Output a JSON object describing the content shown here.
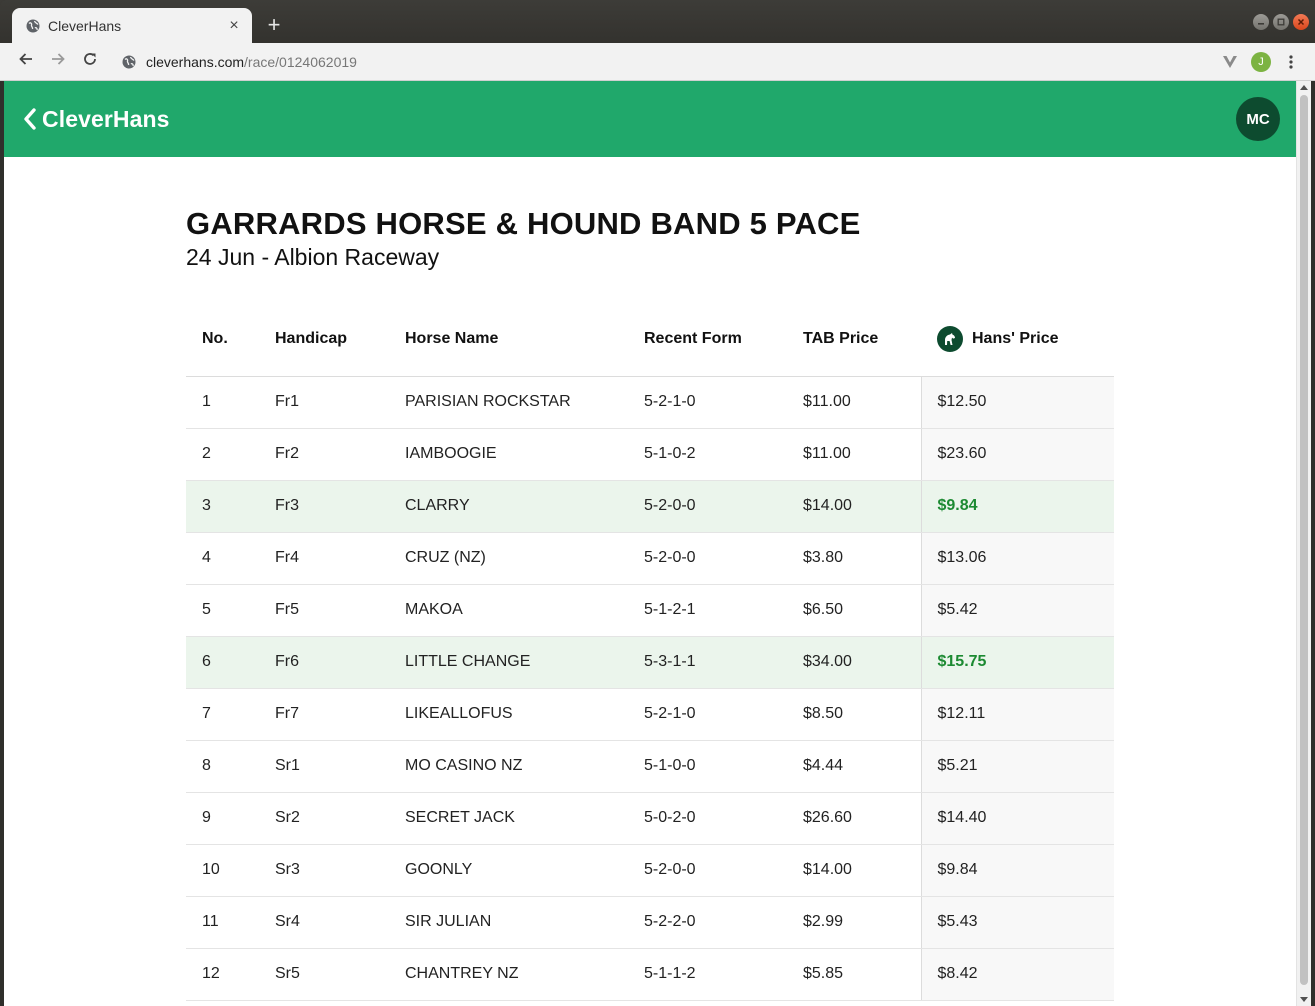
{
  "browser": {
    "tab_title": "CleverHans",
    "tab_close_glyph": "×",
    "new_tab_glyph": "+",
    "url_host": "cleverhans.com",
    "url_path": "/race/0124062019",
    "profile_initial": "J",
    "icons": [
      "globe-icon",
      "back-arrow-icon",
      "forward-arrow-icon",
      "reload-icon",
      "extension-icon",
      "menu-dots-icon"
    ]
  },
  "app": {
    "brand": "CleverHans",
    "avatar_initials": "MC",
    "accent_color": "#20a86b",
    "dark_green": "#0d4b2f",
    "highlight_color": "#1c8a32"
  },
  "race": {
    "title": "GARRARDS HORSE & HOUND BAND 5 PACE",
    "subtitle": "24 Jun - Albion Raceway"
  },
  "table": {
    "headers": {
      "no": "No.",
      "handicap": "Handicap",
      "horse": "Horse Name",
      "form": "Recent Form",
      "tab": "TAB Price",
      "hans": "Hans' Price"
    },
    "rows": [
      {
        "no": "1",
        "handicap": "Fr1",
        "horse": "PARISIAN ROCKSTAR",
        "form": "5-2-1-0",
        "tab": "$11.00",
        "hans": "$12.50",
        "highlight": false
      },
      {
        "no": "2",
        "handicap": "Fr2",
        "horse": "IAMBOOGIE",
        "form": "5-1-0-2",
        "tab": "$11.00",
        "hans": "$23.60",
        "highlight": false
      },
      {
        "no": "3",
        "handicap": "Fr3",
        "horse": "CLARRY",
        "form": "5-2-0-0",
        "tab": "$14.00",
        "hans": "$9.84",
        "highlight": true
      },
      {
        "no": "4",
        "handicap": "Fr4",
        "horse": "CRUZ (NZ)",
        "form": "5-2-0-0",
        "tab": "$3.80",
        "hans": "$13.06",
        "highlight": false
      },
      {
        "no": "5",
        "handicap": "Fr5",
        "horse": "MAKOA",
        "form": "5-1-2-1",
        "tab": "$6.50",
        "hans": "$5.42",
        "highlight": false
      },
      {
        "no": "6",
        "handicap": "Fr6",
        "horse": "LITTLE CHANGE",
        "form": "5-3-1-1",
        "tab": "$34.00",
        "hans": "$15.75",
        "highlight": true
      },
      {
        "no": "7",
        "handicap": "Fr7",
        "horse": "LIKEALLOFUS",
        "form": "5-2-1-0",
        "tab": "$8.50",
        "hans": "$12.11",
        "highlight": false
      },
      {
        "no": "8",
        "handicap": "Sr1",
        "horse": "MO CASINO NZ",
        "form": "5-1-0-0",
        "tab": "$4.44",
        "hans": "$5.21",
        "highlight": false
      },
      {
        "no": "9",
        "handicap": "Sr2",
        "horse": "SECRET JACK",
        "form": "5-0-2-0",
        "tab": "$26.60",
        "hans": "$14.40",
        "highlight": false
      },
      {
        "no": "10",
        "handicap": "Sr3",
        "horse": "GOONLY",
        "form": "5-2-0-0",
        "tab": "$14.00",
        "hans": "$9.84",
        "highlight": false
      },
      {
        "no": "11",
        "handicap": "Sr4",
        "horse": "SIR JULIAN",
        "form": "5-2-2-0",
        "tab": "$2.99",
        "hans": "$5.43",
        "highlight": false
      },
      {
        "no": "12",
        "handicap": "Sr5",
        "horse": "CHANTREY NZ",
        "form": "5-1-1-2",
        "tab": "$5.85",
        "hans": "$8.42",
        "highlight": false
      }
    ]
  }
}
